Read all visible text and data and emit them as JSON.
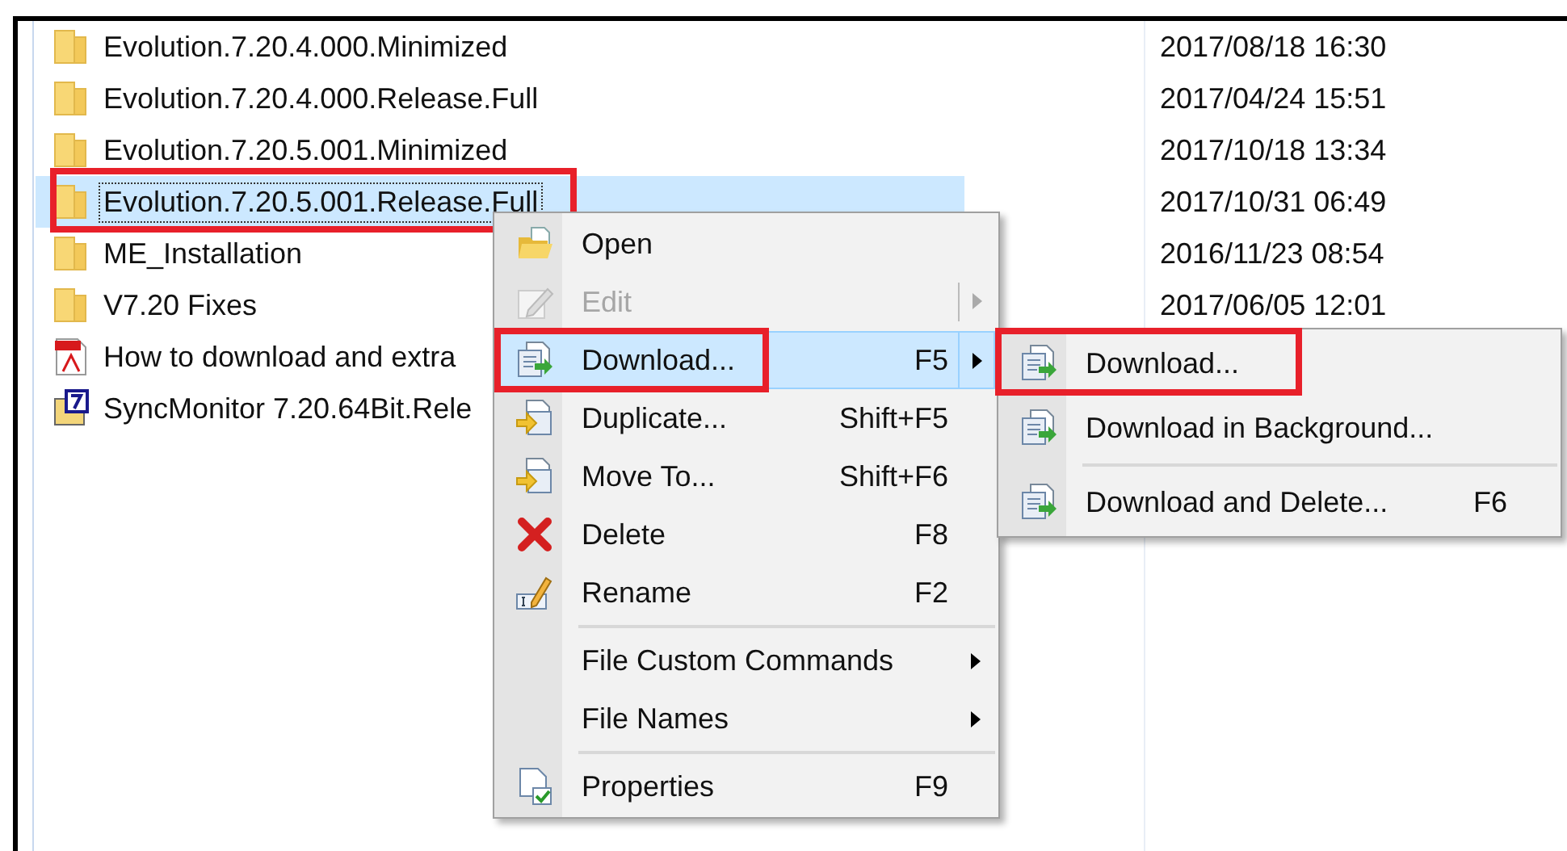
{
  "files": [
    {
      "kind": "folder",
      "name": "Evolution.7.20.4.000.Minimized",
      "date": "2017/08/18 16:30",
      "selected": false,
      "highlighted": false
    },
    {
      "kind": "folder",
      "name": "Evolution.7.20.4.000.Release.Full",
      "date": "2017/04/24 15:51",
      "selected": false,
      "highlighted": false
    },
    {
      "kind": "folder",
      "name": "Evolution.7.20.5.001.Minimized",
      "date": "2017/10/18 13:34",
      "selected": false,
      "highlighted": false
    },
    {
      "kind": "folder",
      "name": "Evolution.7.20.5.001.Release.Full",
      "date": "2017/10/31 06:49",
      "selected": true,
      "highlighted": true
    },
    {
      "kind": "folder",
      "name": "ME_Installation",
      "date": "2016/11/23 08:54",
      "selected": false,
      "highlighted": false
    },
    {
      "kind": "folder",
      "name": "V7.20 Fixes",
      "date": "2017/06/05 12:01",
      "selected": false,
      "highlighted": false
    },
    {
      "kind": "pdf",
      "name": "How to download and extra",
      "selected": false,
      "highlighted": false
    },
    {
      "kind": "app",
      "name": "SyncMonitor 7.20.64Bit.Rele",
      "selected": false,
      "highlighted": false
    }
  ],
  "context_menu": [
    {
      "kind": "item",
      "label": "Open",
      "disabled": false,
      "submenu": false,
      "selected": false,
      "highlighted": false
    },
    {
      "kind": "item",
      "label": "Edit",
      "disabled": true,
      "submenu": true,
      "selected": false,
      "highlighted": false
    },
    {
      "kind": "item",
      "label": "Download...",
      "shortcut": "F5",
      "disabled": false,
      "submenu": true,
      "selected": true,
      "highlighted": true
    },
    {
      "kind": "item",
      "label": "Duplicate...",
      "shortcut": "Shift+F5",
      "disabled": false,
      "submenu": false,
      "selected": false,
      "highlighted": false
    },
    {
      "kind": "item",
      "label": "Move To...",
      "shortcut": "Shift+F6",
      "disabled": false,
      "submenu": false,
      "selected": false,
      "highlighted": false
    },
    {
      "kind": "item",
      "label": "Delete",
      "shortcut": "F8",
      "disabled": false,
      "submenu": false,
      "selected": false,
      "highlighted": false
    },
    {
      "kind": "item",
      "label": "Rename",
      "shortcut": "F2",
      "disabled": false,
      "submenu": false,
      "selected": false,
      "highlighted": false
    },
    {
      "kind": "separator"
    },
    {
      "kind": "item",
      "label": "File Custom Commands",
      "disabled": false,
      "submenu": true,
      "selected": false,
      "highlighted": false
    },
    {
      "kind": "item",
      "label": "File Names",
      "disabled": false,
      "submenu": true,
      "selected": false,
      "highlighted": false
    },
    {
      "kind": "separator"
    },
    {
      "kind": "item",
      "label": "Properties",
      "shortcut": "F9",
      "disabled": false,
      "submenu": false,
      "selected": false,
      "highlighted": false
    }
  ],
  "submenu": [
    {
      "kind": "item",
      "label": "Download...",
      "highlighted": true
    },
    {
      "kind": "item",
      "label": "Download in Background...",
      "highlighted": false
    },
    {
      "kind": "separator"
    },
    {
      "kind": "item",
      "label": "Download and Delete...",
      "shortcut": "F6",
      "highlighted": false
    }
  ]
}
